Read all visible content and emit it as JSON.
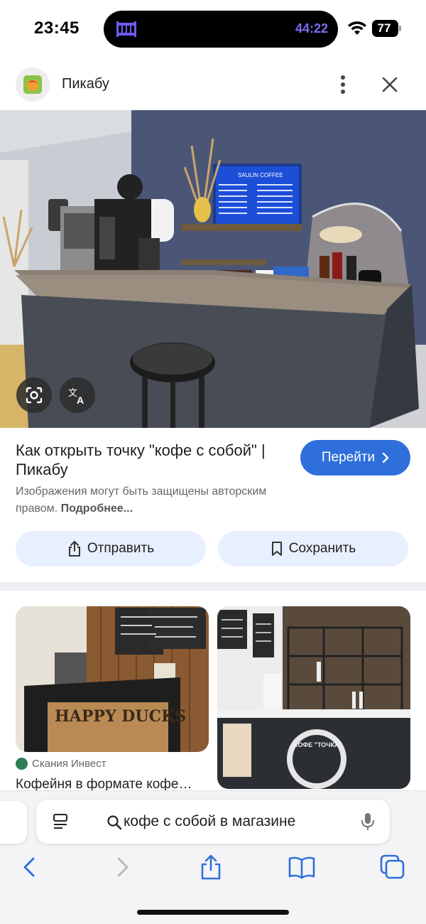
{
  "status_bar": {
    "time": "23:45",
    "timer": "44:22",
    "battery": "77"
  },
  "header": {
    "site_name": "Пикабу"
  },
  "result": {
    "title": "Как открыть точку \"кофе с собой\" | Пикабу",
    "go_button": "Перейти",
    "copyright_text": "Изображения могут быть защищены авторским правом.",
    "copyright_link": "Подробнее..."
  },
  "actions": {
    "share_label": "Отправить",
    "save_label": "Сохранить"
  },
  "related": [
    {
      "source": "Скания Инвест",
      "caption": "Кофейня в формате кофе…",
      "image_text": "HAPPY DUCKS"
    },
    {
      "image_text": "КОФЕ \"ТОЧКА\""
    }
  ],
  "hero": {
    "sign_text": "SAULIN COFFEE"
  },
  "address_bar": {
    "query": "кофе с собой в магазине"
  },
  "colors": {
    "accent": "#2f6fdc",
    "chip_bg": "#e8efff",
    "timer": "#7b6cf6"
  },
  "icons": [
    "crib-icon",
    "wifi-icon",
    "battery-icon",
    "more-icon",
    "close-icon",
    "lens-icon",
    "translate-icon",
    "share-icon",
    "bookmark-icon",
    "reader-icon",
    "search-icon",
    "mic-icon",
    "back-icon",
    "forward-icon",
    "bookmarks-icon",
    "tabs-icon"
  ]
}
